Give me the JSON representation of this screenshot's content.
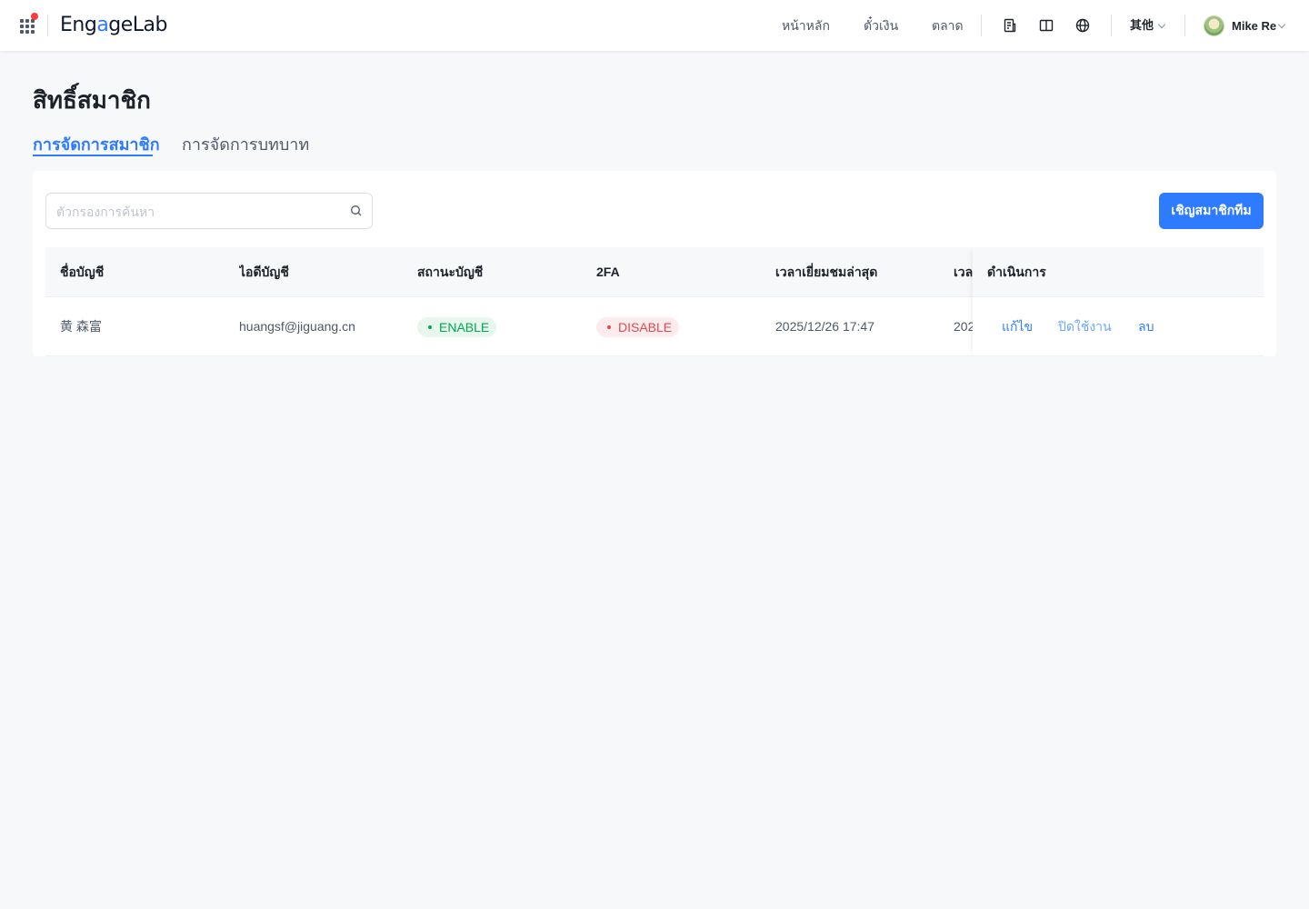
{
  "nav": {
    "logo": {
      "prefix": "Eng",
      "accent": "a",
      "suffix": "geLab"
    },
    "links": [
      "หน้าหลัก",
      "ตั๋วเงิน",
      "ตลาด"
    ],
    "icons": [
      "document-icon",
      "book-icon",
      "globe-icon"
    ],
    "more_label": "其他",
    "user_name": "Mike Re"
  },
  "page": {
    "title": "สิทธิ์สมาชิก",
    "tabs": [
      {
        "label": "การจัดการสมาชิก",
        "active": true
      },
      {
        "label": "การจัดการบทบาท",
        "active": false
      }
    ]
  },
  "toolbar": {
    "search_placeholder": "ตัวกรองการค้นหา",
    "search_value": "",
    "invite_label": "เชิญสมาชิกทีม"
  },
  "table": {
    "columns": [
      "ชื่อบัญชี",
      "ไอดีบัญชี",
      "สถานะบัญชี",
      "2FA",
      "เวลาเยี่ยมชมล่าสุด",
      "เวลา",
      "ดำเนินการ"
    ],
    "rows": [
      {
        "name": "黄 森富",
        "account_id": "huangsf@jiguang.cn",
        "status": "ENABLE",
        "twofa": "DISABLE",
        "last_visit": "2025/12/26 17:47",
        "time_partial": "202",
        "actions": [
          "แก้ไข",
          "ปิดใช้งาน",
          "ลบ"
        ]
      }
    ]
  },
  "colors": {
    "accent": "#2f7bff",
    "enable": "#00a854",
    "disable": "#e5484d",
    "background": "#f7f8fa"
  }
}
